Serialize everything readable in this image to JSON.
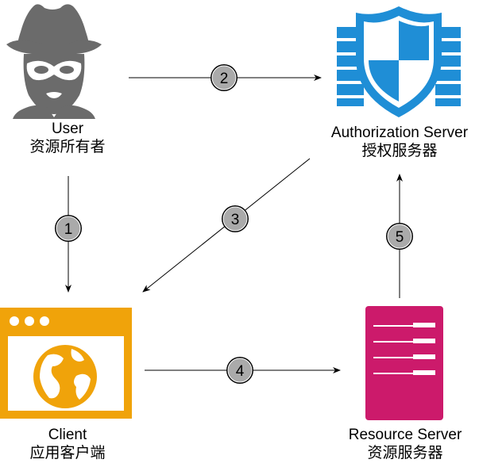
{
  "nodes": {
    "user": {
      "label_en": "User",
      "label_cn": "资源所有者",
      "icon": "spy-icon"
    },
    "auth_server": {
      "label_en": "Authorization Server",
      "label_cn": "授权服务器",
      "icon": "shield-firewall-icon"
    },
    "client": {
      "label_en": "Client",
      "label_cn": "应用客户端",
      "icon": "browser-globe-icon"
    },
    "resource_server": {
      "label_en": "Resource Server",
      "label_cn": "资源服务器",
      "icon": "server-icon"
    }
  },
  "steps": [
    {
      "num": "1",
      "from": "user",
      "to": "client"
    },
    {
      "num": "2",
      "from": "user",
      "to": "auth_server"
    },
    {
      "num": "3",
      "from": "auth_server",
      "to": "client"
    },
    {
      "num": "4",
      "from": "client",
      "to": "resource_server"
    },
    {
      "num": "5",
      "from": "resource_server",
      "to": "auth_server"
    }
  ],
  "colors": {
    "user_icon": "#6b6b6b",
    "shield_blue": "#1f8ed6",
    "client_orange": "#f0a30a",
    "server_magenta": "#cc1a6b",
    "step_badge_fill": "#aaaaaa",
    "arrow": "#000000"
  }
}
